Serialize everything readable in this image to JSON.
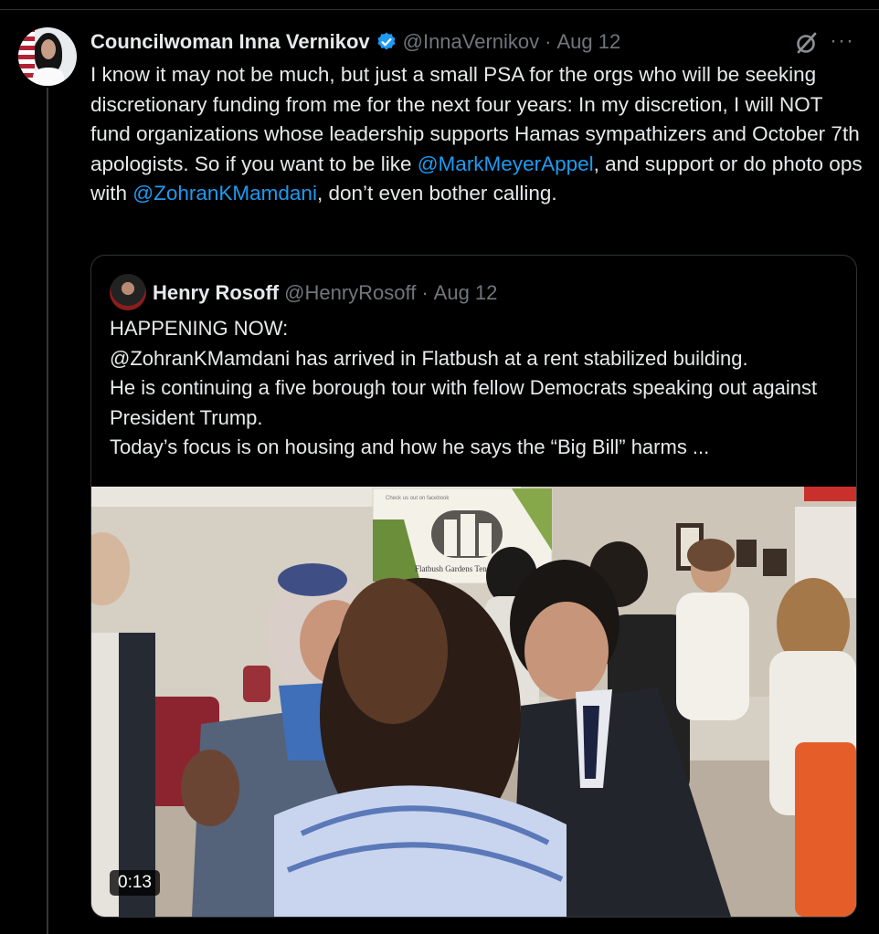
{
  "tweet": {
    "author_name": "Councilwoman Inna Vernikov",
    "handle": "@InnaVernikov",
    "separator": "·",
    "date": "Aug 12",
    "more": "···",
    "text_part1": "I know it may not be much, but just a small PSA for the orgs who will be seeking discretionary funding from me for the next four years: In my discretion, I will NOT fund organizations whose leadership supports Hamas sympathizers and October 7th apologists. So if you want to be like ",
    "mention1": "@MarkMeyerAppel",
    "text_part2": ", and support or do photo ops with ",
    "mention2": "@ZohranKMamdani",
    "text_part3": ", don’t even bother calling."
  },
  "quote": {
    "author_name": "Henry Rosoff",
    "handle": "@HenryRosoff",
    "separator": "·",
    "date": "Aug 12",
    "line1": "HAPPENING NOW:",
    "line2": "@ZohranKMamdani has arrived in Flatbush at a rent stabilized building.",
    "line3": "He is continuing a five borough tour with fellow Democrats speaking out against President Trump.",
    "line4": "Today’s focus is on housing and how he says the “Big Bill” harms ...",
    "video_duration": "0:13",
    "sign_text": "Flatbush Gardens Tenants",
    "sign_top_text": "Check us out on facebook"
  },
  "colors": {
    "accent": "#1d9bf0",
    "text": "#e7e9ea",
    "muted": "#71767b",
    "border": "#2f3336"
  },
  "icons": [
    "verified-badge-icon",
    "grok-icon",
    "more-icon"
  ]
}
